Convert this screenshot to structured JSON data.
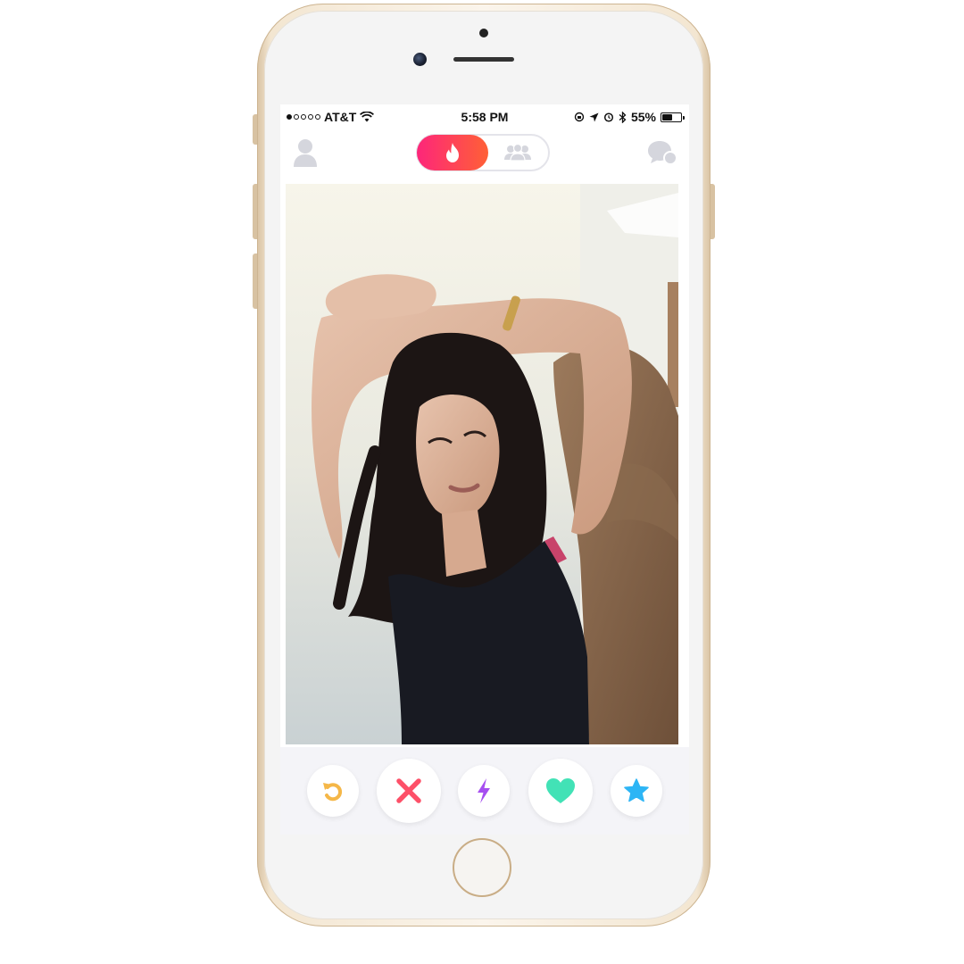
{
  "status_bar": {
    "carrier": "AT&T",
    "time": "5:58 PM",
    "battery": "55%",
    "battery_level": 0.55
  },
  "top_nav": {
    "profile_icon": "profile-icon",
    "toggle_active_icon": "flame-icon",
    "toggle_inactive_icon": "group-icon",
    "chat_icon": "chat-icon"
  },
  "card": {
    "photo": "profile-photo"
  },
  "actions": [
    {
      "name": "rewind-button",
      "icon": "rewind-icon",
      "color": "#f5b748"
    },
    {
      "name": "nope-button",
      "icon": "close-icon",
      "color": "#fd5068"
    },
    {
      "name": "boost-button",
      "icon": "lightning-icon",
      "color": "#a64ef0"
    },
    {
      "name": "like-button",
      "icon": "heart-icon",
      "color": "#42e2b6"
    },
    {
      "name": "super-like-button",
      "icon": "star-icon",
      "color": "#2db5f5"
    }
  ],
  "colors": {
    "brand_gradient_start": "#fd267a",
    "brand_gradient_end": "#ff6036",
    "inactive_icon": "#d5d6dd"
  }
}
